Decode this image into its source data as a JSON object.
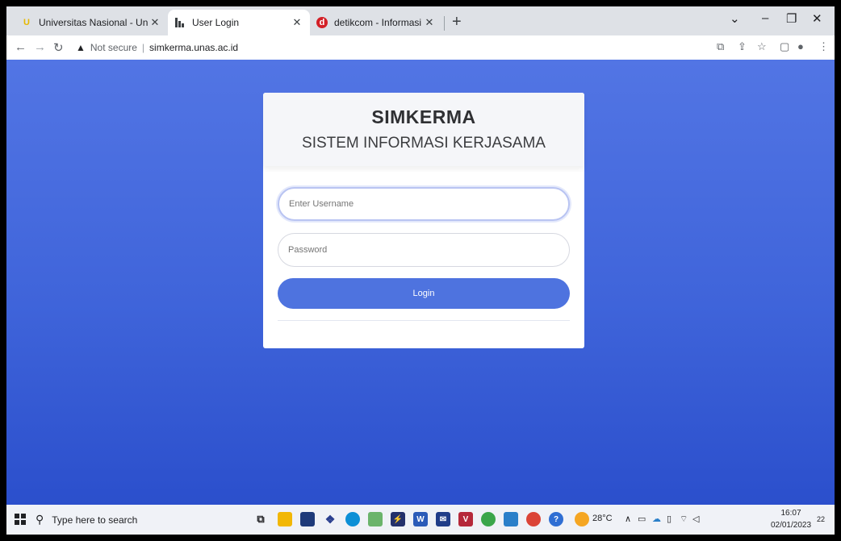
{
  "tabs": [
    {
      "label": "Universitas Nasional - Universitas",
      "favicon": "U"
    },
    {
      "label": "User Login",
      "favicon": "bars"
    },
    {
      "label": "detikcom - Informasi Berita Terk",
      "favicon": "d"
    }
  ],
  "address": {
    "security": "Not secure",
    "url": "simkerma.unas.ac.id"
  },
  "login": {
    "title": "SIMKERMA",
    "subtitle": "SISTEM INFORMASI KERJASAMA",
    "username_placeholder": "Enter Username",
    "password_placeholder": "Password",
    "button": "Login"
  },
  "taskbar": {
    "search_placeholder": "Type here to search",
    "weather": "28°C",
    "time": "16:07",
    "date": "02/01/2023",
    "notifications": "22"
  },
  "colors": {
    "page_bg": "#4a6ee0",
    "primary": "#4e73df",
    "chrome": "#dee1e6"
  }
}
